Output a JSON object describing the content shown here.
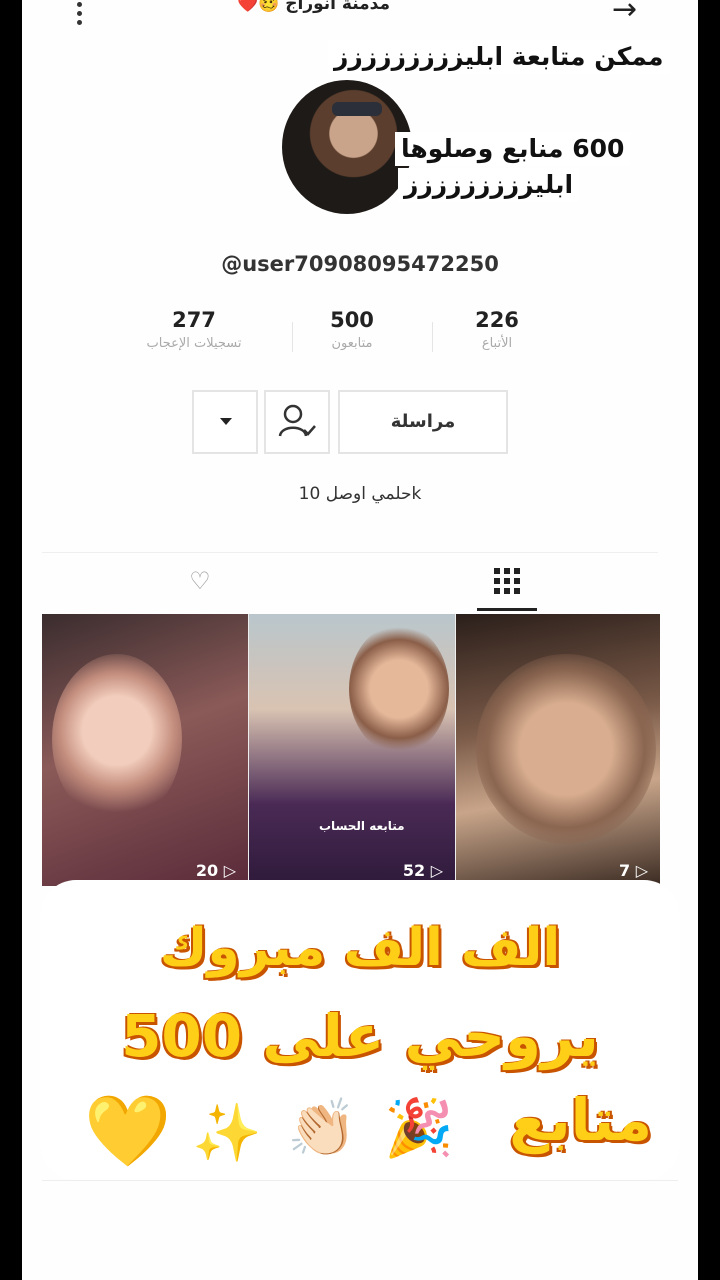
{
  "header": {
    "title": "مدمنة انوراج 🥴❤️",
    "back_icon": "arrow-right-icon",
    "more_icon": "more-vertical-icon"
  },
  "overlay_text": {
    "line1": "ممكن متابعة ابليززززززززز",
    "line2": "600 منابع وصلوها",
    "line3": "ابليززززززززز"
  },
  "profile": {
    "username": "@user70908095472250",
    "stats": [
      {
        "value": "226",
        "label": "الأتباع"
      },
      {
        "value": "500",
        "label": "متابعون"
      },
      {
        "value": "277",
        "label": "تسجيلات الإعجاب"
      }
    ],
    "message_button": "مراسلة",
    "bio": "حلمي اوصل 10k"
  },
  "tabs": {
    "videos_icon": "grid-icon",
    "liked_icon": "heart-lock-icon"
  },
  "videos": [
    {
      "views": "20"
    },
    {
      "views": "52",
      "caption": "متابعه الحساب"
    },
    {
      "views": "7"
    }
  ],
  "congrats": {
    "line1": "الف الف مبروك",
    "line2": "يروحي على 500",
    "line3": "متابع",
    "emojis": [
      "🎉",
      "👏🏻",
      "✨",
      "💛"
    ]
  },
  "colors": {
    "congrats_text": "#ffcf18",
    "congrats_outline": "#c95400",
    "heart": "#ffc12e"
  }
}
